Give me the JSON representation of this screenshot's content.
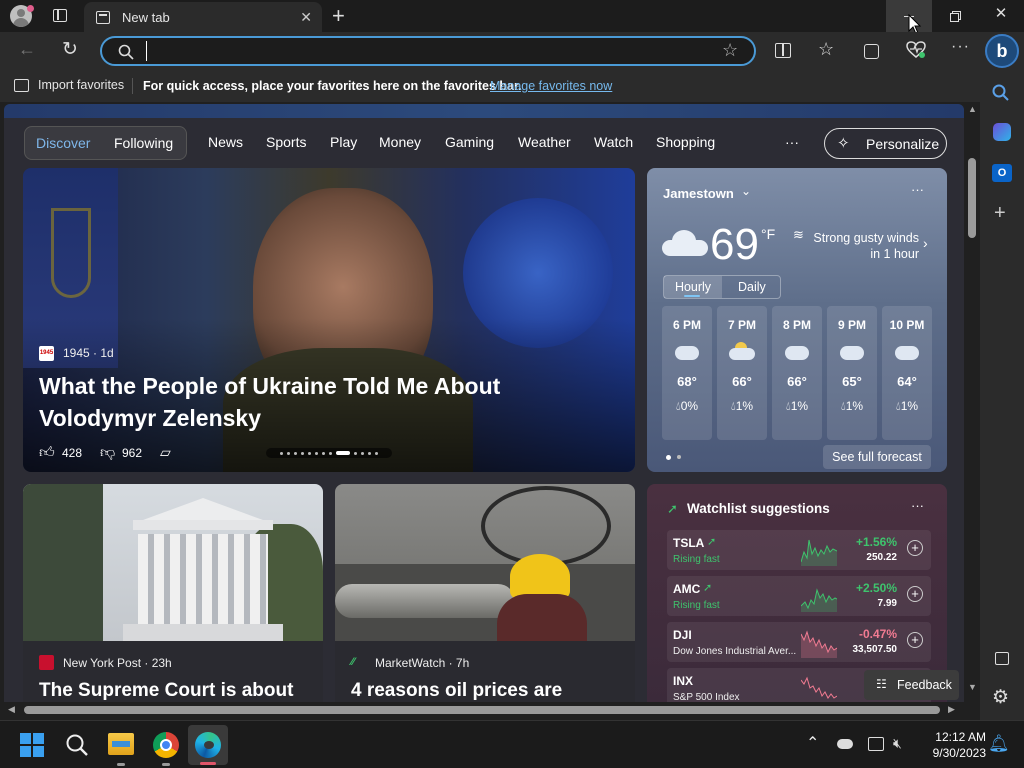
{
  "browser": {
    "tab_title": "New tab",
    "address_placeholder": "",
    "favorites": {
      "import_label": "Import favorites",
      "hint": "For quick access, place your favorites here on the favorites bar.",
      "manage_link": "Manage favorites now"
    }
  },
  "nav": {
    "discover": "Discover",
    "following": "Following",
    "items": [
      "News",
      "Sports",
      "Play",
      "Money",
      "Gaming",
      "Weather",
      "Watch",
      "Shopping"
    ],
    "more": "···",
    "personalize": "Personalize"
  },
  "hero": {
    "source": "1945 · 1d",
    "source_logo": "1945",
    "title_line1": "What the People of Ukraine Told Me About",
    "title_line2": "Volodymyr Zelensky",
    "likes": "428",
    "dislikes": "962"
  },
  "weather": {
    "location": "Jamestown",
    "temp": "69",
    "unit": "°F",
    "alert_line1": "Strong gusty winds",
    "alert_line2": "in 1 hour",
    "tab_hourly": "Hourly",
    "tab_daily": "Daily",
    "hours": [
      {
        "time": "6 PM",
        "temp": "68°",
        "precip": "0%",
        "icon": "cloud-icon"
      },
      {
        "time": "7 PM",
        "temp": "66°",
        "precip": "1%",
        "icon": "partly-cloudy-night-icon"
      },
      {
        "time": "8 PM",
        "temp": "66°",
        "precip": "1%",
        "icon": "cloud-icon"
      },
      {
        "time": "9 PM",
        "temp": "65°",
        "precip": "1%",
        "icon": "cloud-icon"
      },
      {
        "time": "10 PM",
        "temp": "64°",
        "precip": "1%",
        "icon": "cloud-icon"
      }
    ],
    "forecast_link": "See full forecast"
  },
  "cards": [
    {
      "source": "New York Post · 23h",
      "title": "The Supreme Court is about"
    },
    {
      "source": "MarketWatch · 7h",
      "title": "4 reasons oil prices are"
    }
  ],
  "watchlist": {
    "title": "Watchlist suggestions",
    "items": [
      {
        "symbol": "TSLA",
        "sub": "Rising fast",
        "change": "+1.56%",
        "price": "250.22",
        "color": "#3ec46d"
      },
      {
        "symbol": "AMC",
        "sub": "Rising fast",
        "change": "+2.50%",
        "price": "7.99",
        "color": "#3ec46d"
      },
      {
        "symbol": "DJI",
        "sub": "Dow Jones Industrial Aver...",
        "change": "-0.47%",
        "price": "33,507.50",
        "color": "#f27b92"
      },
      {
        "symbol": "INX",
        "sub": "S&P 500 Index",
        "change": "",
        "price": "",
        "color": "#f27b92"
      }
    ]
  },
  "feedback": "Feedback",
  "clock": {
    "time": "12:12 AM",
    "date": "9/30/2023"
  },
  "colors": {
    "accent": "#4a9ad6",
    "positive": "#3ec46d",
    "negative": "#f27b92"
  }
}
